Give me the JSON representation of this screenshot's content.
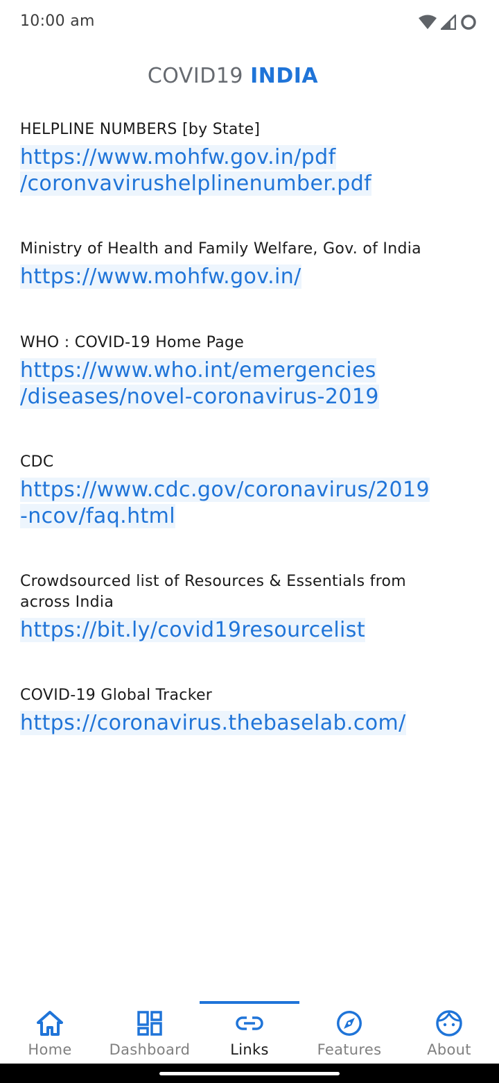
{
  "status_bar": {
    "time": "10:00 am",
    "icons": [
      "wifi-icon",
      "cell-signal-icon",
      "circle-status-icon"
    ]
  },
  "header": {
    "title_main": "COVID19",
    "title_accent": "INDIA",
    "accent_color": "#1f74d8"
  },
  "links": [
    {
      "label": "HELPLINE NUMBERS [by State]",
      "url_lines": [
        "https://www.mohfw.gov.in/pdf",
        "/coronvavirushelplinenumber.pdf"
      ]
    },
    {
      "label": "Ministry of Health and Family Welfare, Gov. of India",
      "url_lines": [
        "https://www.mohfw.gov.in/"
      ]
    },
    {
      "label": "WHO : COVID-19 Home Page",
      "url_lines": [
        "https://www.who.int/emergencies",
        "/diseases/novel-coronavirus-2019"
      ]
    },
    {
      "label": "CDC",
      "url_lines": [
        "https://www.cdc.gov/coronavirus/2019",
        "-ncov/faq.html"
      ]
    },
    {
      "label_lines": [
        "Crowdsourced list of Resources & Essentials from",
        "across India"
      ],
      "url_lines": [
        "https://bit.ly/covid19resourcelist"
      ]
    },
    {
      "label": "COVID-19 Global Tracker",
      "url_lines": [
        "https://coronavirus.thebaselab.com/"
      ]
    }
  ],
  "bottom_nav": {
    "active": "Links",
    "items": [
      {
        "label": "Home",
        "icon": "home-icon"
      },
      {
        "label": "Dashboard",
        "icon": "dashboard-icon"
      },
      {
        "label": "Links",
        "icon": "link-icon"
      },
      {
        "label": "Features",
        "icon": "compass-icon"
      },
      {
        "label": "About",
        "icon": "face-icon"
      }
    ]
  }
}
